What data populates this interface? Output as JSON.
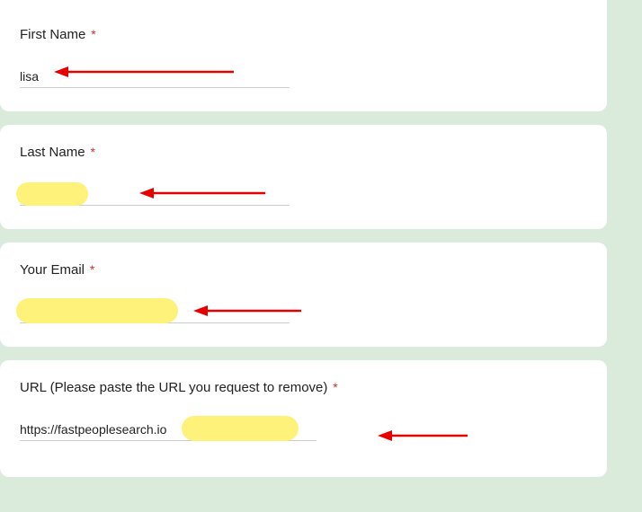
{
  "fields": {
    "first_name": {
      "label": "First Name",
      "value": "lisa"
    },
    "last_name": {
      "label": "Last Name",
      "value": ""
    },
    "email": {
      "label": "Your Email",
      "value": ""
    },
    "url": {
      "label": "URL (Please paste the URL you request to remove)",
      "value": "https://fastpeoplesearch.io"
    }
  },
  "required_marker": "*"
}
